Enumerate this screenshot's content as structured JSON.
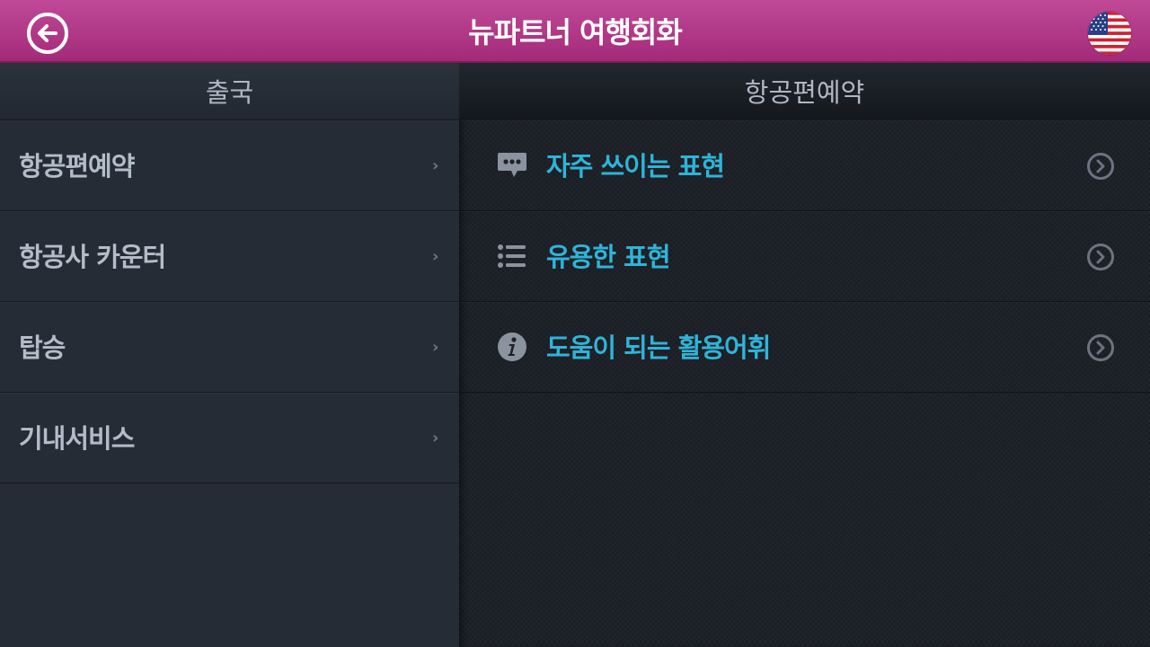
{
  "app": {
    "title": "뉴파트너 여행회화",
    "back_icon": "back-arrow-circle-icon",
    "language_icon": "us-flag-icon"
  },
  "left_panel": {
    "header": "출국",
    "items": [
      {
        "label": "항공편예약"
      },
      {
        "label": "항공사 카운터"
      },
      {
        "label": "탑승"
      },
      {
        "label": "기내서비스"
      }
    ]
  },
  "right_panel": {
    "header": "항공편예약",
    "items": [
      {
        "label": "자주 쓰이는 표현",
        "icon": "speech-bubble-icon"
      },
      {
        "label": "유용한 표현",
        "icon": "list-icon"
      },
      {
        "label": "도움이 되는 활용어휘",
        "icon": "info-icon"
      }
    ]
  },
  "colors": {
    "header_accent": "#b33b8a",
    "link_text": "#2fb4d8",
    "panel_bg": "#262c36"
  }
}
